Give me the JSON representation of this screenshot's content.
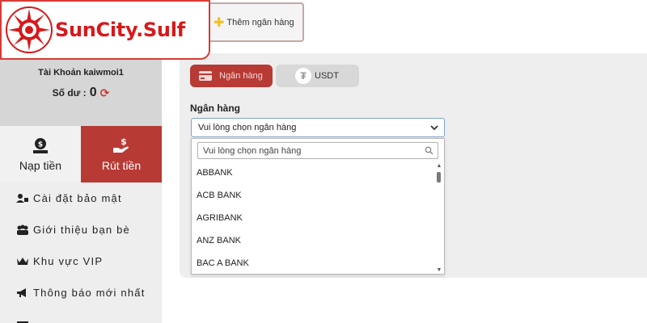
{
  "logo": {
    "text": "SunCity.Sulf"
  },
  "top_tab": {
    "label": "Thêm ngân hàng"
  },
  "account": {
    "name": "Tài Khoản kaiwmoi1",
    "balance_label": "Số dư :",
    "balance_value": "0"
  },
  "actions": {
    "deposit": "Nạp tiền",
    "withdraw": "Rút tiền"
  },
  "menu": {
    "items": [
      {
        "label": "Cài đặt bảo mật",
        "icon": "user-lock-icon"
      },
      {
        "label": "Giới thiệu bạn bè",
        "icon": "friends-icon"
      },
      {
        "label": "Khu vực VIP",
        "icon": "vip-crown-icon"
      },
      {
        "label": "Thông báo mới nhất",
        "icon": "megaphone-icon"
      }
    ]
  },
  "tabs": {
    "bank": "Ngân hàng",
    "usdt": "USDT"
  },
  "form": {
    "bank_label": "Ngân hàng",
    "bank_select_value": "Vui lòng chọn ngân hàng"
  },
  "dropdown": {
    "search_placeholder": "Vui lòng chọn ngân hàng",
    "options": [
      "ABBANK",
      "ACB BANK",
      "AGRIBANK",
      "ANZ BANK",
      "BAC A BANK"
    ]
  },
  "colors": {
    "brand_red": "#d6191b",
    "active_tab": "#b83a34",
    "sidebar_gray": "#d6d6d6"
  }
}
